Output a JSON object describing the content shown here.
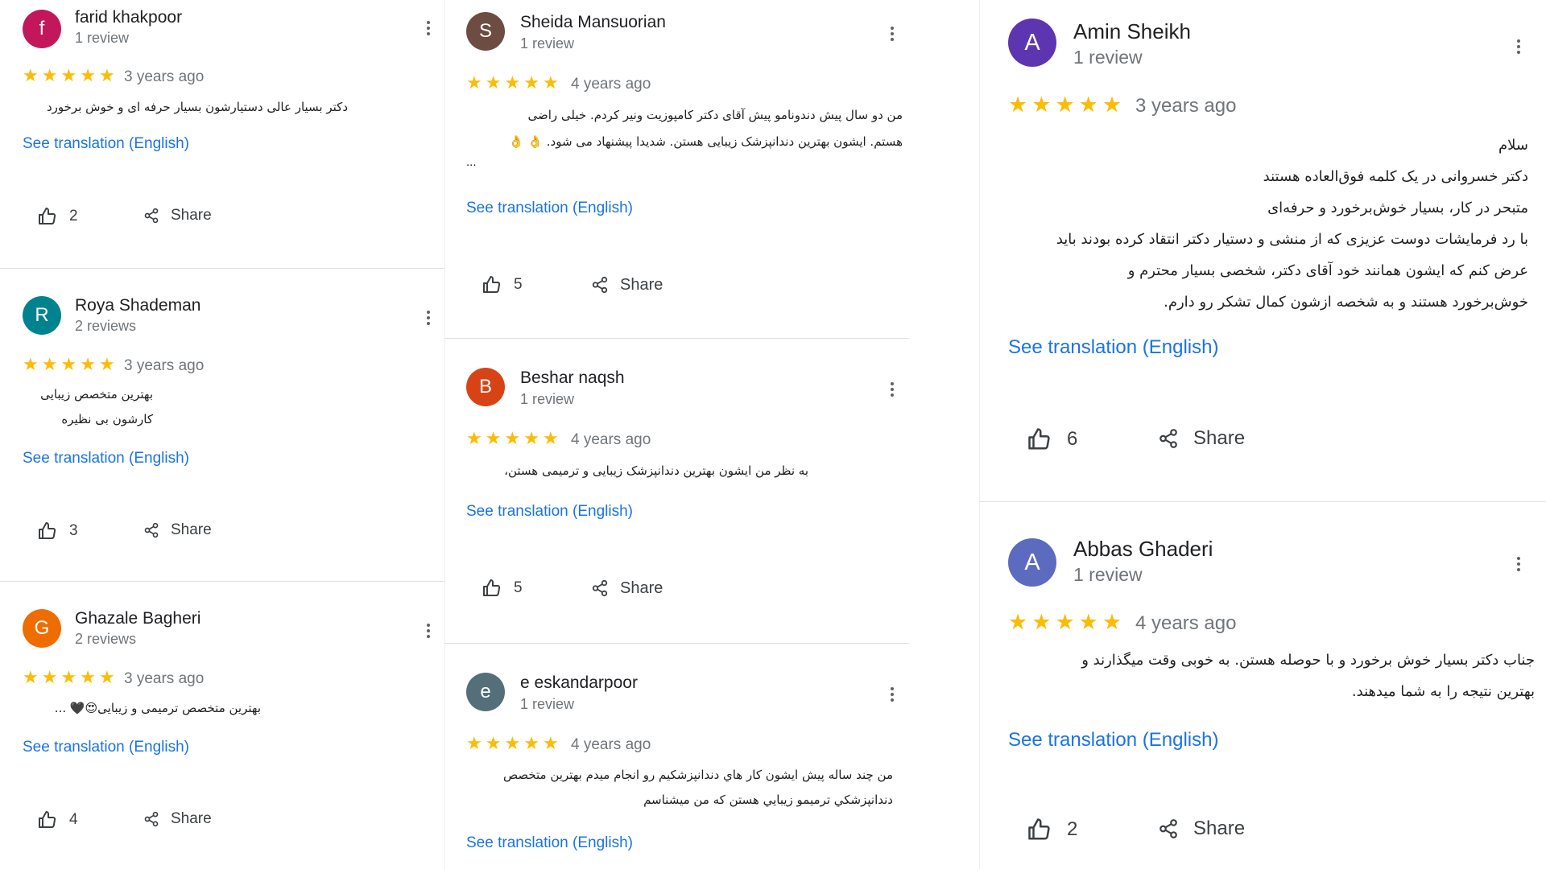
{
  "common": {
    "see_translation": "See translation (English)",
    "share_label": "Share",
    "star_glyph": "★"
  },
  "colors": {
    "star": "#fbbc04",
    "link": "#1a73e8"
  },
  "reviews": [
    {
      "name": "farid khakpoor",
      "initial": "f",
      "avatar_color": "#c2185b",
      "count_label": "1 review",
      "time": "3 years ago",
      "stars": 5,
      "text": "دکتر بسیار عالی دستیارشون بسیار حرفه ای و خوش برخورد",
      "likes": "2"
    },
    {
      "name": "Roya Shademan",
      "initial": "R",
      "avatar_color": "#00838f",
      "count_label": "2 reviews",
      "time": "3 years ago",
      "stars": 5,
      "text": "بهترین متخصص زیبایی\nکارشون بی نظیره",
      "likes": "3"
    },
    {
      "name": "Ghazale Bagheri",
      "initial": "G",
      "avatar_color": "#ef6c00",
      "count_label": "2 reviews",
      "time": "3 years ago",
      "stars": 5,
      "text": "بهترین متخصص ترمیمی و زیبایی😍🖤 ...",
      "likes": "4"
    },
    {
      "name": "Sheida Mansuorian",
      "initial": "S",
      "avatar_color": "#6d4c41",
      "count_label": "1 review",
      "time": "4 years ago",
      "stars": 5,
      "text": "من دو سال پیش دندونامو پیش آقای دکتر کامپوزیت ونیر کردم. خیلی راضی\nهستم. ایشون بهترین دندانپزشک زیبایی هستن. شدیدا پیشنهاد می شود. 👌 👌",
      "ellipsis": "...",
      "likes": "5"
    },
    {
      "name": "Beshar naqsh",
      "initial": "B",
      "avatar_color": "#d84315",
      "count_label": "1 review",
      "time": "4 years ago",
      "stars": 5,
      "text": "به نظر من ایشون بهترین دندانپزشک زیبایی و ترمیمی هستن،",
      "likes": "5"
    },
    {
      "name": "e eskandarpoor",
      "initial": "e",
      "avatar_color": "#546e7a",
      "count_label": "1 review",
      "time": "4 years ago",
      "stars": 5,
      "text": "من چند ساله پيش ايشون كار هاي دندانپزشكيم رو انجام ميدم بهترين متخصص\nدندانپزشكي ترميمو زيبايي هستن كه من ميشناسم",
      "likes": ""
    },
    {
      "name": "Amin Sheikh",
      "initial": "A",
      "avatar_color": "#5e35b1",
      "count_label": "1 review",
      "time": "3 years ago",
      "stars": 5,
      "text": "سلام\nدکتر خسروانی در یک کلمه فوق‌العاده هستند\nمتبحر در کار، بسیار خوش‌برخورد و حرفه‌ای\nبا رد فرمایشات دوست عزیزی که از منشی و دستیار دکتر انتقاد کرده بودند باید\nعرض کنم که ایشون همانند خود آقای دکتر، شخصی بسیار محترم و\nخوش‌برخورد هستند و به شخصه ازشون کمال تشکر رو دارم.",
      "likes": "6"
    },
    {
      "name": "Abbas Ghaderi",
      "initial": "A",
      "avatar_color": "#5c6bc0",
      "count_label": "1 review",
      "time": "4 years ago",
      "stars": 5,
      "text": "جناب دکتر بسیار خوش برخورد و با حوصله هستن. به خوبی وقت میگذارند و\nبهترین نتیجه را به شما میدهند.",
      "likes": "2"
    }
  ]
}
